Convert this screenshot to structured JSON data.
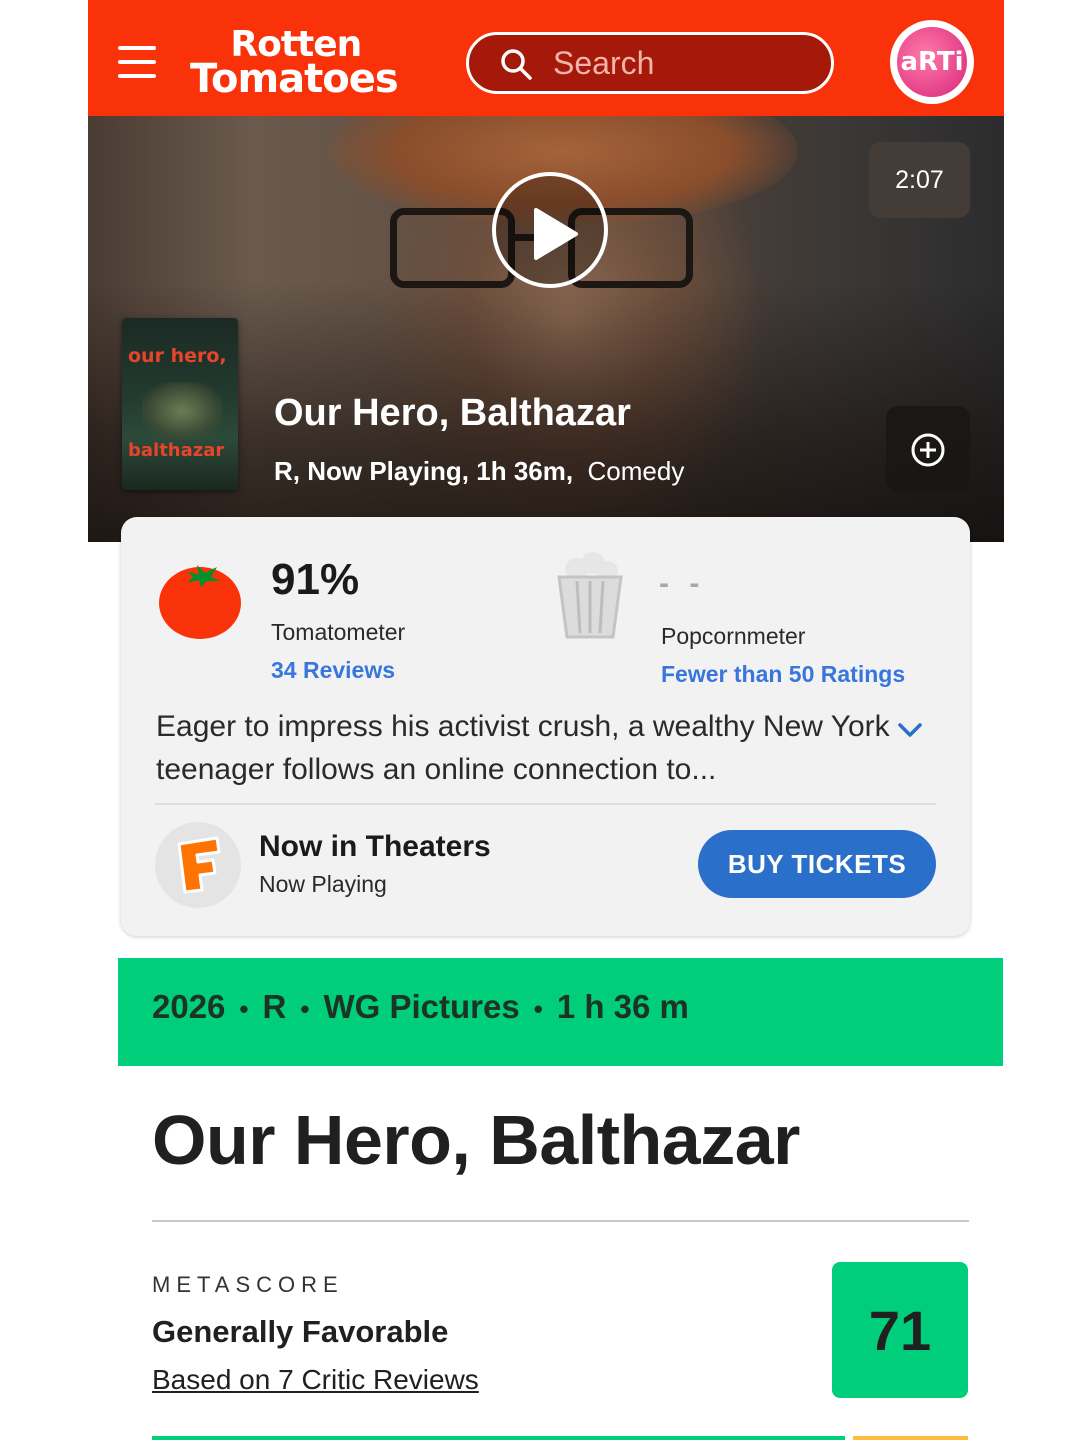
{
  "header": {
    "logo_line1": "Rotten",
    "logo_line2": "Tomatoes",
    "search_placeholder": "Search",
    "avatar_text": "aRTi",
    "colors": {
      "brand": "#fa320a",
      "search_bg": "#a5190a"
    }
  },
  "hero": {
    "duration": "2:07",
    "title": "Our Hero, Balthazar",
    "meta_bold": "R, Now Playing, 1h 36m,",
    "genre": "Comedy",
    "poster_text_top": "our hero,",
    "poster_text_bottom": "balthazar"
  },
  "scores": {
    "tomatometer": {
      "score": "91%",
      "label": "Tomatometer",
      "reviews_link": "34 Reviews"
    },
    "popcornmeter": {
      "score": "- -",
      "label": "Popcornmeter",
      "ratings_link": "Fewer than 50 Ratings"
    },
    "synopsis": "Eager to impress his activist crush, a wealthy New York teenager follows an online connection to...",
    "link_color": "#3976dc"
  },
  "theaters": {
    "title": "Now in Theaters",
    "subtitle": "Now Playing",
    "buy_label": "BUY TICKETS",
    "button_color": "#2a6fc9"
  },
  "metacritic": {
    "bar_items": [
      "2026",
      "R",
      "WG Pictures",
      "1 h 36 m"
    ],
    "bar_color": "#00ce7a",
    "title": "Our Hero, Balthazar",
    "label": "METASCORE",
    "verdict": "Generally Favorable",
    "reviews_link": "Based on 7 Critic Reviews",
    "score": "71"
  }
}
